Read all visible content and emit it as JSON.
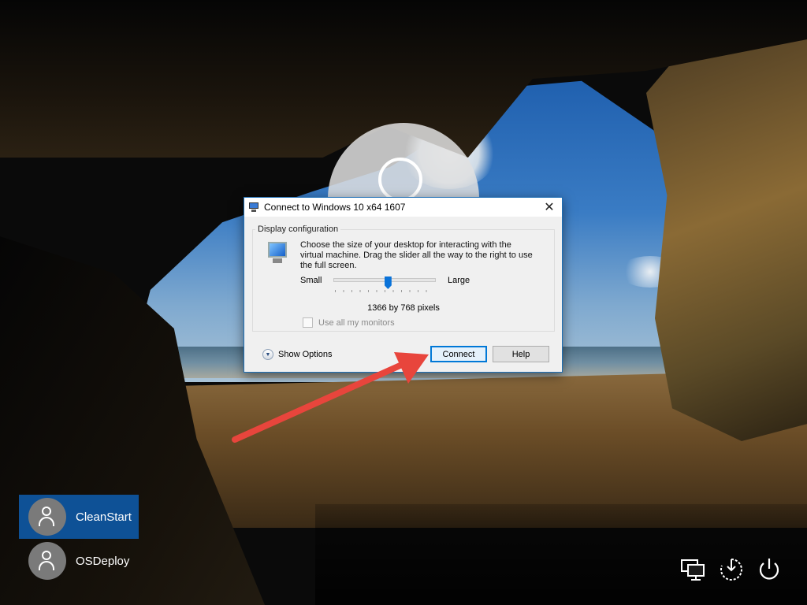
{
  "dialog": {
    "title": "Connect to Windows 10 x64 1607",
    "group_label": "Display configuration",
    "description": "Choose the size of your desktop for interacting with the virtual machine. Drag the slider all the way to the right to use the full screen.",
    "slider": {
      "min_label": "Small",
      "max_label": "Large",
      "position": 0.53
    },
    "resolution": "1366 by 768 pixels",
    "checkbox_label": "Use all my monitors",
    "checkbox_checked": false,
    "show_options": "Show Options",
    "connect": "Connect",
    "help": "Help",
    "close_glyph": "✕"
  },
  "users": [
    {
      "name": "CleanStart",
      "active": true
    },
    {
      "name": "OSDeploy",
      "active": false
    }
  ],
  "system_icons": [
    "network-icon",
    "accessibility-icon",
    "power-icon"
  ],
  "colors": {
    "accent": "#0e5196",
    "arrow": "#e8453c",
    "button_focus": "#0078d7"
  }
}
